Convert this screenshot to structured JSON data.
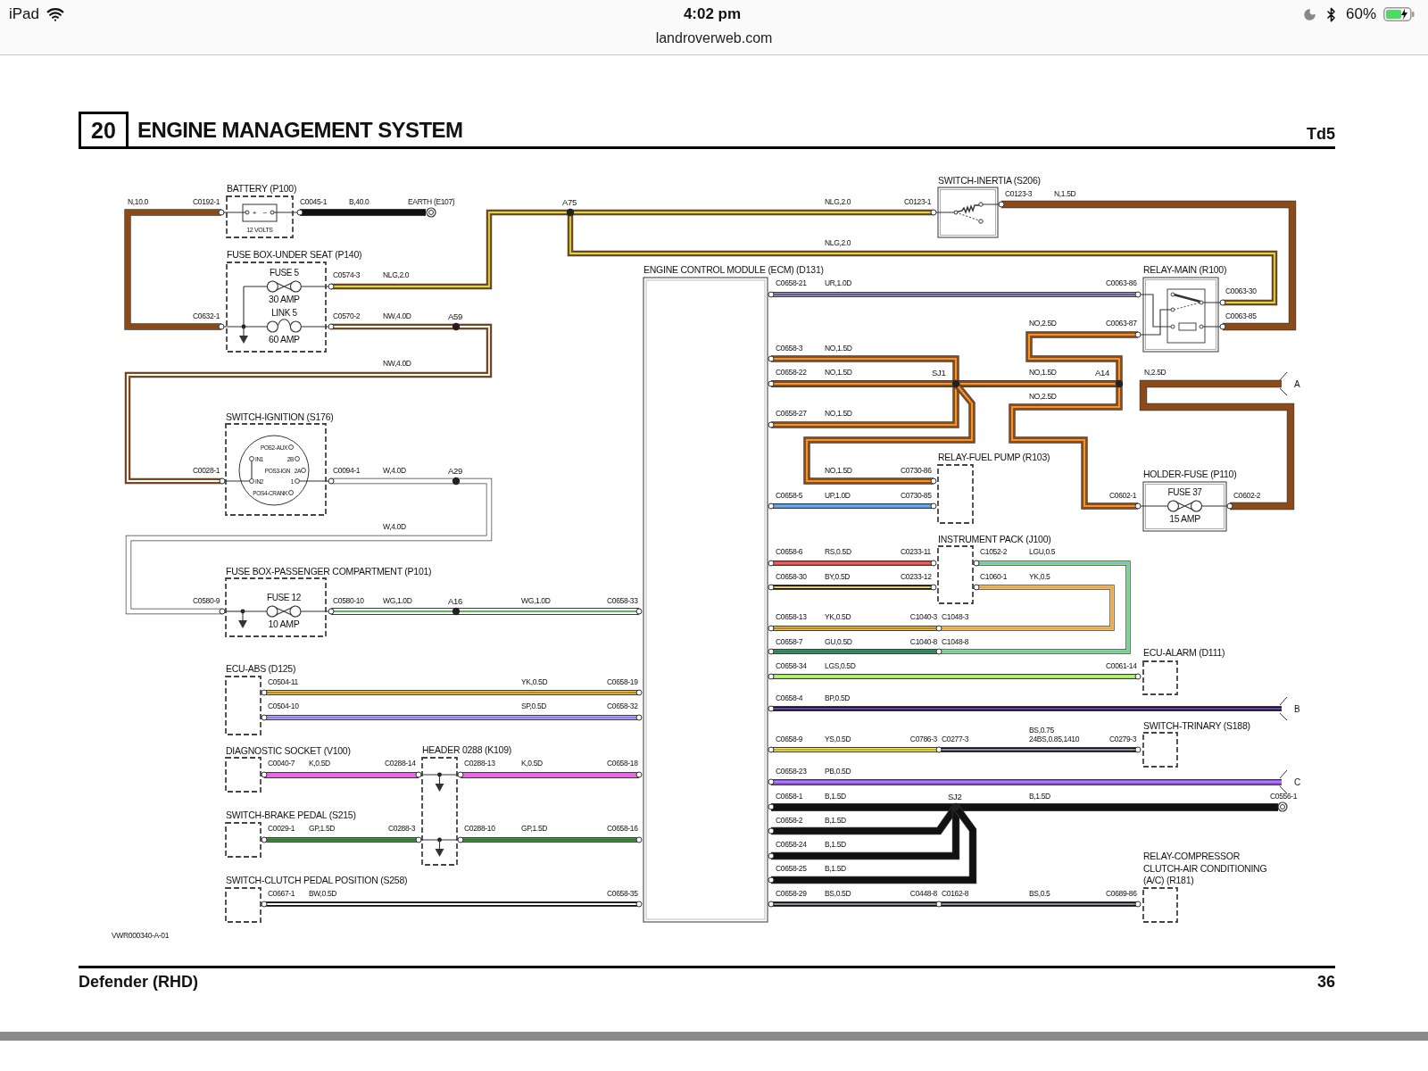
{
  "status_bar": {
    "device": "iPad",
    "time": "4:02 pm",
    "url": "landroverweb.com",
    "battery": "60%"
  },
  "document": {
    "section_number": "20",
    "title": "ENGINE MANAGEMENT SYSTEM",
    "model": "Td5",
    "footer_title": "Defender (RHD)",
    "page_number": "36"
  },
  "diagram": {
    "components": [
      {
        "name_lines": [
          "BATTERY (P100)"
        ],
        "kind": "battery",
        "texts": [
          "+",
          "−",
          "12 VOLTS"
        ]
      },
      {
        "name_lines": [
          "SWITCH-INERTIA (S206)"
        ],
        "kind": "inertia-switch"
      },
      {
        "name_lines": [
          "FUSE BOX-UNDER SEAT (P140)"
        ],
        "kind": "fuse-box",
        "fuses": [
          {
            "label": "FUSE 5",
            "rating": "30 AMP",
            "kind": "fuse"
          },
          {
            "label": "LINK 5",
            "rating": "60 AMP",
            "kind": "link"
          }
        ]
      },
      {
        "name_lines": [
          "ENGINE CONTROL MODULE (ECM) (D131)"
        ],
        "kind": "ecm"
      },
      {
        "name_lines": [
          "RELAY-MAIN (R100)"
        ],
        "kind": "relay"
      },
      {
        "name_lines": [
          "SWITCH-IGNITION (S176)"
        ],
        "kind": "ignition-switch",
        "texts": [
          "POS2-AUX",
          "IN1",
          "2B",
          "POS3-IGN",
          "2A",
          "IN2",
          "1",
          "POS4-CRANK"
        ]
      },
      {
        "name_lines": [
          "RELAY-FUEL PUMP (R103)"
        ],
        "kind": "module"
      },
      {
        "name_lines": [
          "HOLDER-FUSE (P110)"
        ],
        "kind": "fuse-holder",
        "fuses": [
          {
            "label": "FUSE 37",
            "rating": "15 AMP",
            "kind": "fuse"
          }
        ]
      },
      {
        "name_lines": [
          "INSTRUMENT PACK (J100)"
        ],
        "kind": "module"
      },
      {
        "name_lines": [
          "FUSE BOX-PASSENGER COMPARTMENT (P101)"
        ],
        "kind": "fuse-box",
        "fuses": [
          {
            "label": "FUSE 12",
            "rating": "10 AMP",
            "kind": "fuse"
          }
        ]
      },
      {
        "name_lines": [
          "ECU-ALARM (D111)"
        ],
        "kind": "module"
      },
      {
        "name_lines": [
          "ECU-ABS (D125)"
        ],
        "kind": "module"
      },
      {
        "name_lines": [
          "SWITCH-TRINARY (S188)"
        ],
        "kind": "module"
      },
      {
        "name_lines": [
          "DIAGNOSTIC SOCKET (V100)"
        ],
        "kind": "module"
      },
      {
        "name_lines": [
          "HEADER 0288 (K109)"
        ],
        "kind": "header"
      },
      {
        "name_lines": [
          "SWITCH-BRAKE PEDAL (S215)"
        ],
        "kind": "module"
      },
      {
        "name_lines": [
          "SWITCH-CLUTCH PEDAL POSITION (S258)"
        ],
        "kind": "module"
      },
      {
        "name_lines": [
          "RELAY-COMPRESSOR",
          "CLUTCH-AIR CONDITIONING",
          "(A/C) (R181)"
        ],
        "kind": "module"
      }
    ],
    "wires": [
      {
        "color": "#8b4a17"
      },
      {
        "color": "#111111"
      },
      {
        "color": "#8b4a17",
        "tracer": {
          "color": "#c8e040"
        }
      },
      {
        "color": "#8b4a17",
        "tracer": {
          "color": "#c8e040"
        }
      },
      {
        "color": "#8b4a17"
      },
      {
        "color": "#8b4a17",
        "tracer": {
          "color": "#ffffff"
        }
      },
      {
        "color": "#ffffff"
      },
      {
        "color": "#ffffff",
        "tracer": {
          "color": "#5cb85c"
        }
      },
      {
        "color": "#f0c850",
        "tracer": {
          "color": "#b8862a"
        }
      },
      {
        "color": "#b3aef0",
        "tracer": {
          "color": "#8f7fe0"
        }
      },
      {
        "color": "#e866e8"
      },
      {
        "color": "#e866e8"
      },
      {
        "color": "#45a045",
        "tracer": {
          "color": "#2f7a2f"
        }
      },
      {
        "color": "#45a045",
        "tracer": {
          "color": "#2f7a2f"
        }
      },
      {
        "color": "#111111",
        "tracer": {
          "color": "#ffffff"
        }
      },
      {
        "color": "#5ab0ee",
        "tracer": {
          "color": "#b04060"
        }
      },
      {
        "color": "#8b4a17",
        "tracer": {
          "color": "#f0962e"
        }
      },
      {
        "color": "#8b4a17",
        "tracer": {
          "color": "#f0962e"
        }
      },
      {
        "color": "#8b4a17",
        "tracer": {
          "color": "#f0962e"
        }
      },
      {
        "color": "#8b4a17",
        "tracer": {
          "color": "#f0962e"
        }
      },
      {
        "color": "#8b4a17",
        "tracer": {
          "color": "#f0962e"
        }
      },
      {
        "color": "#8b4a17",
        "tracer": {
          "color": "#f0962e"
        }
      },
      {
        "color": "#8b4a17"
      },
      {
        "color": "#4a90e8",
        "tracer": {
          "color": "#6aaaf0"
        }
      },
      {
        "color": "#e53935",
        "tracer": {
          "color": "#f06060"
        }
      },
      {
        "color": "#111111",
        "tracer": {
          "color": "#f0d040"
        }
      },
      {
        "color": "#8ee85a",
        "tracer": {
          "color": "#70c0e0"
        }
      },
      {
        "color": "#f0c850",
        "tracer": {
          "color": "#e8a070"
        }
      },
      {
        "color": "#f0c850",
        "tracer": {
          "color": "#b8862a"
        }
      },
      {
        "color": "#3a9a50",
        "tracer": {
          "color": "#2b8070"
        }
      },
      {
        "color": "#9ce65a",
        "tracer": {
          "color": "#b8f080"
        }
      },
      {
        "color": "#111111",
        "tracer": {
          "color": "#7040c0"
        }
      },
      {
        "color": "#ece878",
        "tracer": {
          "color": "#c8b020"
        }
      },
      {
        "color": "#111111",
        "tracer": {
          "color": "#9090a0"
        }
      },
      {
        "color": "#8a48e8",
        "tracer": {
          "color": "#b080f8"
        }
      },
      {
        "color": "#111111"
      },
      {
        "color": "#111111"
      },
      {
        "color": "#111111"
      },
      {
        "color": "#111111"
      },
      {
        "color": "#111111",
        "tracer": {
          "color": "#9090a0"
        }
      }
    ],
    "labels": [
      {
        "text": "N,10.0",
        "kind": "wire"
      },
      {
        "text": "C0192-1",
        "kind": "connector"
      },
      {
        "text": "C0045-1",
        "kind": "connector"
      },
      {
        "text": "B,40.0",
        "kind": "wire"
      },
      {
        "text": "EARTH (E107)",
        "kind": "connector"
      },
      {
        "text": "A75",
        "kind": "splice"
      },
      {
        "text": "NLG,2.0",
        "kind": "wire"
      },
      {
        "text": "C0123-1",
        "kind": "connector"
      },
      {
        "text": "C0123-3",
        "kind": "connector"
      },
      {
        "text": "N,1.5D",
        "kind": "wire"
      },
      {
        "text": "NLG,2.0",
        "kind": "wire"
      },
      {
        "text": "C0574-3",
        "kind": "connector"
      },
      {
        "text": "NLG,2.0",
        "kind": "wire"
      },
      {
        "text": "C0658-21",
        "kind": "connector"
      },
      {
        "text": "UR,1.0D",
        "kind": "wire"
      },
      {
        "text": "C0063-86",
        "kind": "connector"
      },
      {
        "text": "C0063-30",
        "kind": "connector"
      },
      {
        "text": "C0632-1",
        "kind": "connector"
      },
      {
        "text": "C0570-2",
        "kind": "connector"
      },
      {
        "text": "NW,4.0D",
        "kind": "wire"
      },
      {
        "text": "A59",
        "kind": "splice"
      },
      {
        "text": "C0063-85",
        "kind": "connector"
      },
      {
        "text": "NO,2.5D",
        "kind": "wire"
      },
      {
        "text": "C0063-87",
        "kind": "connector"
      },
      {
        "text": "C0658-3",
        "kind": "connector"
      },
      {
        "text": "NO,1.5D",
        "kind": "wire"
      },
      {
        "text": "NW,4.0D",
        "kind": "wire"
      },
      {
        "text": "C0658-22",
        "kind": "connector"
      },
      {
        "text": "NO,1.5D",
        "kind": "wire"
      },
      {
        "text": "SJ1",
        "kind": "splice"
      },
      {
        "text": "NO,1.5D",
        "kind": "wire"
      },
      {
        "text": "A14",
        "kind": "splice"
      },
      {
        "text": "N,2.5D",
        "kind": "wire"
      },
      {
        "text": "A",
        "kind": "ref"
      },
      {
        "text": "NO,2.5D",
        "kind": "wire"
      },
      {
        "text": "C0658-27",
        "kind": "connector"
      },
      {
        "text": "NO,1.5D",
        "kind": "wire"
      },
      {
        "text": "C0028-1",
        "kind": "connector"
      },
      {
        "text": "C0094-1",
        "kind": "connector"
      },
      {
        "text": "W,4.0D",
        "kind": "wire"
      },
      {
        "text": "A29",
        "kind": "splice"
      },
      {
        "text": "NO,1.5D",
        "kind": "wire"
      },
      {
        "text": "C0730-86",
        "kind": "connector"
      },
      {
        "text": "C0658-5",
        "kind": "connector"
      },
      {
        "text": "UP,1.0D",
        "kind": "wire"
      },
      {
        "text": "C0730-85",
        "kind": "connector"
      },
      {
        "text": "C0602-1",
        "kind": "connector"
      },
      {
        "text": "C0602-2",
        "kind": "connector"
      },
      {
        "text": "W,4.0D",
        "kind": "wire"
      },
      {
        "text": "C0658-6",
        "kind": "connector"
      },
      {
        "text": "RS,0.5D",
        "kind": "wire"
      },
      {
        "text": "C0233-11",
        "kind": "connector"
      },
      {
        "text": "C1052-2",
        "kind": "connector"
      },
      {
        "text": "LGU,0.5",
        "kind": "wire"
      },
      {
        "text": "C0658-30",
        "kind": "connector"
      },
      {
        "text": "BY,0.5D",
        "kind": "wire"
      },
      {
        "text": "C0233-12",
        "kind": "connector"
      },
      {
        "text": "C1060-1",
        "kind": "connector"
      },
      {
        "text": "YK,0.5",
        "kind": "wire"
      },
      {
        "text": "C0580-9",
        "kind": "connector"
      },
      {
        "text": "C0580-10",
        "kind": "connector"
      },
      {
        "text": "WG,1.0D",
        "kind": "wire"
      },
      {
        "text": "A16",
        "kind": "splice"
      },
      {
        "text": "WG,1.0D",
        "kind": "wire"
      },
      {
        "text": "C0658-33",
        "kind": "connector"
      },
      {
        "text": "C0658-13",
        "kind": "connector"
      },
      {
        "text": "YK,0.5D",
        "kind": "wire"
      },
      {
        "text": "C1040-3",
        "kind": "connector"
      },
      {
        "text": "C1048-3",
        "kind": "connector"
      },
      {
        "text": "C0658-7",
        "kind": "connector"
      },
      {
        "text": "GU,0.5D",
        "kind": "wire"
      },
      {
        "text": "C1040-8",
        "kind": "connector"
      },
      {
        "text": "C1048-8",
        "kind": "connector"
      },
      {
        "text": "C0658-34",
        "kind": "connector"
      },
      {
        "text": "LGS,0.5D",
        "kind": "wire"
      },
      {
        "text": "C0061-14",
        "kind": "connector"
      },
      {
        "text": "C0504-11",
        "kind": "connector"
      },
      {
        "text": "YK,0.5D",
        "kind": "wire"
      },
      {
        "text": "C0658-19",
        "kind": "connector"
      },
      {
        "text": "C0658-4",
        "kind": "connector"
      },
      {
        "text": "BP,0.5D",
        "kind": "wire"
      },
      {
        "text": "C0504-10",
        "kind": "connector"
      },
      {
        "text": "SP,0.5D",
        "kind": "wire"
      },
      {
        "text": "C0658-32",
        "kind": "connector"
      },
      {
        "text": "B",
        "kind": "ref"
      },
      {
        "text": "BS,0.75",
        "kind": "wire"
      },
      {
        "text": "C0658-9",
        "kind": "connector"
      },
      {
        "text": "YS,0.5D",
        "kind": "wire"
      },
      {
        "text": "C0786-3",
        "kind": "connector"
      },
      {
        "text": "C0277-3",
        "kind": "connector"
      },
      {
        "text": "24BS,0.85,1410",
        "kind": "wire"
      },
      {
        "text": "C0279-3",
        "kind": "connector"
      },
      {
        "text": "C0040-7",
        "kind": "connector"
      },
      {
        "text": "K,0.5D",
        "kind": "wire"
      },
      {
        "text": "C0288-14",
        "kind": "connector"
      },
      {
        "text": "C0288-13",
        "kind": "connector"
      },
      {
        "text": "K,0.5D",
        "kind": "wire"
      },
      {
        "text": "C0658-18",
        "kind": "connector"
      },
      {
        "text": "C0658-23",
        "kind": "connector"
      },
      {
        "text": "PB,0.5D",
        "kind": "wire"
      },
      {
        "text": "C",
        "kind": "ref"
      },
      {
        "text": "C0658-1",
        "kind": "connector"
      },
      {
        "text": "B,1.5D",
        "kind": "wire"
      },
      {
        "text": "SJ2",
        "kind": "splice"
      },
      {
        "text": "B,1.5D",
        "kind": "wire"
      },
      {
        "text": "C0556-1",
        "kind": "connector"
      },
      {
        "text": "C0658-2",
        "kind": "connector"
      },
      {
        "text": "B,1.5D",
        "kind": "wire"
      },
      {
        "text": "C0029-1",
        "kind": "connector"
      },
      {
        "text": "GP,1.5D",
        "kind": "wire"
      },
      {
        "text": "C0288-3",
        "kind": "connector"
      },
      {
        "text": "C0288-10",
        "kind": "connector"
      },
      {
        "text": "GP,1.5D",
        "kind": "wire"
      },
      {
        "text": "C0658-16",
        "kind": "connector"
      },
      {
        "text": "C0658-24",
        "kind": "connector"
      },
      {
        "text": "B,1.5D",
        "kind": "wire"
      },
      {
        "text": "C0658-25",
        "kind": "connector"
      },
      {
        "text": "B,1.5D",
        "kind": "wire"
      },
      {
        "text": "C0667-1",
        "kind": "connector"
      },
      {
        "text": "BW,0.5D",
        "kind": "wire"
      },
      {
        "text": "C0658-35",
        "kind": "connector"
      },
      {
        "text": "C0658-29",
        "kind": "connector"
      },
      {
        "text": "BS,0.5D",
        "kind": "wire"
      },
      {
        "text": "C0448-8",
        "kind": "connector"
      },
      {
        "text": "C0162-8",
        "kind": "connector"
      },
      {
        "text": "BS,0.5",
        "kind": "wire"
      },
      {
        "text": "C0689-86",
        "kind": "connector"
      },
      {
        "text": "VWR000340-A-01",
        "kind": "figure"
      }
    ]
  }
}
